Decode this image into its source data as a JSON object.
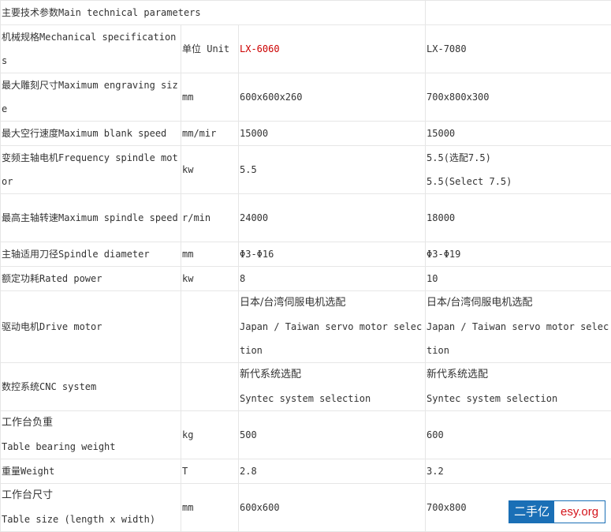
{
  "header": {
    "title": "主要技术参数Main technical parameters"
  },
  "columns": {
    "spec": "机械规格Mechanical specifications",
    "unit": "单位  Unit",
    "model_a": "LX-6060",
    "model_b": "LX-7080"
  },
  "rows": [
    {
      "name": "最大雕刻尺寸Maximum engraving size",
      "unit": "mm",
      "a": [
        "600x600x260"
      ],
      "b": [
        "700x800x300"
      ]
    },
    {
      "name": "最大空行速度Maximum blank speed",
      "unit": "mm/mir",
      "a": [
        "15000"
      ],
      "b": [
        "15000"
      ]
    },
    {
      "name": "变频主轴电机Frequency spindle motor",
      "unit": "kw",
      "a": [
        "5.5"
      ],
      "b": [
        "5.5(选配7.5)",
        "5.5(Select 7.5)"
      ]
    },
    {
      "name": "最高主轴转速Maximum spindle speed",
      "unit": "r/min",
      "a": [
        "24000"
      ],
      "b": [
        "18000"
      ]
    },
    {
      "name": "主轴适用刀径Spindle diameter",
      "unit": "mm",
      "a": [
        "Φ3-Φ16"
      ],
      "b": [
        "Φ3-Φ19"
      ]
    },
    {
      "name": "额定功耗Rated power",
      "unit": "kw",
      "a": [
        "8"
      ],
      "b": [
        "10"
      ]
    },
    {
      "name": "驱动电机Drive motor",
      "unit": "",
      "a": [
        "日本/台湾伺服电机选配",
        "Japan / Taiwan servo motor selection"
      ],
      "b": [
        "日本/台湾伺服电机选配",
        "Japan / Taiwan servo motor selection"
      ]
    },
    {
      "name": "数控系统CNC system",
      "unit": "",
      "a": [
        "新代系统选配",
        "Syntec system selection"
      ],
      "b": [
        "新代系统选配",
        "Syntec system selection"
      ]
    },
    {
      "name_lines": [
        "工作台负重",
        "Table bearing weight"
      ],
      "unit": "kg",
      "a": [
        "500"
      ],
      "b": [
        "600"
      ]
    },
    {
      "name": "重量Weight",
      "unit": "T",
      "a": [
        "2.8"
      ],
      "b": [
        "3.2"
      ]
    },
    {
      "name_lines": [
        "工作台尺寸",
        "Table size (length x width)"
      ],
      "unit": "mm",
      "a": [
        "600x600"
      ],
      "b": [
        "700x800"
      ]
    }
  ],
  "watermark": {
    "left": "二手亿",
    "right": "esy.org"
  }
}
